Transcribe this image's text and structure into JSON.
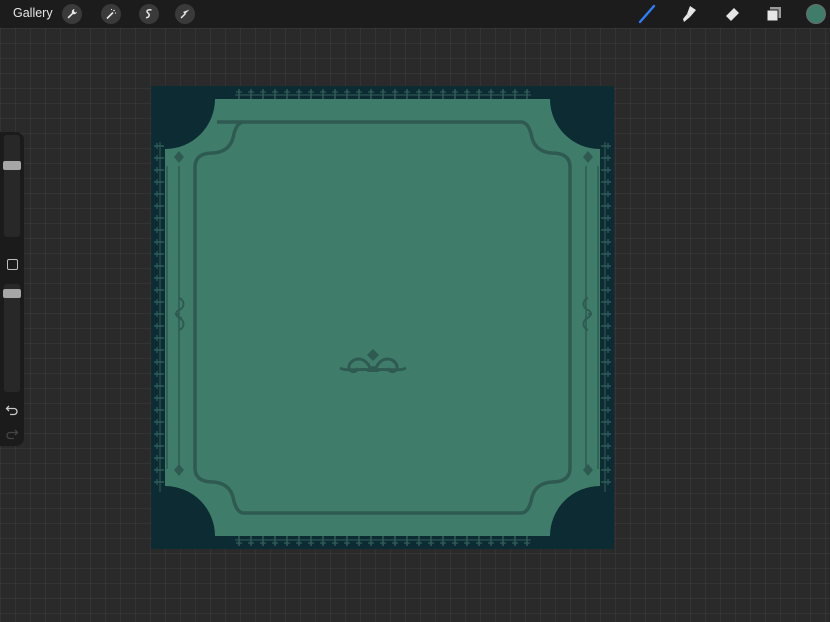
{
  "topbar": {
    "gallery_label": "Gallery",
    "left_tools": [
      {
        "icon": "wrench-icon"
      },
      {
        "icon": "magic-wand-icon"
      },
      {
        "icon": "selection-icon"
      },
      {
        "icon": "transform-arrow-icon"
      }
    ],
    "right_tools": [
      {
        "icon": "brush-icon",
        "active": true
      },
      {
        "icon": "smudge-icon"
      },
      {
        "icon": "eraser-icon"
      },
      {
        "icon": "layers-icon"
      }
    ],
    "current_color": "#3f7d6a"
  },
  "sidebar": {
    "size_slider_level": 0.72,
    "opacity_slider_level": 0.95,
    "modify_button": "square-icon",
    "undo": "undo-icon",
    "redo": "redo-icon"
  },
  "canvas": {
    "background_color": "#0c2b33",
    "frame_fill": "#3f7d6a",
    "frame_line": "#2f5a52",
    "ornament_color": "#325f5a",
    "background_grid": "#2a2a2a"
  }
}
